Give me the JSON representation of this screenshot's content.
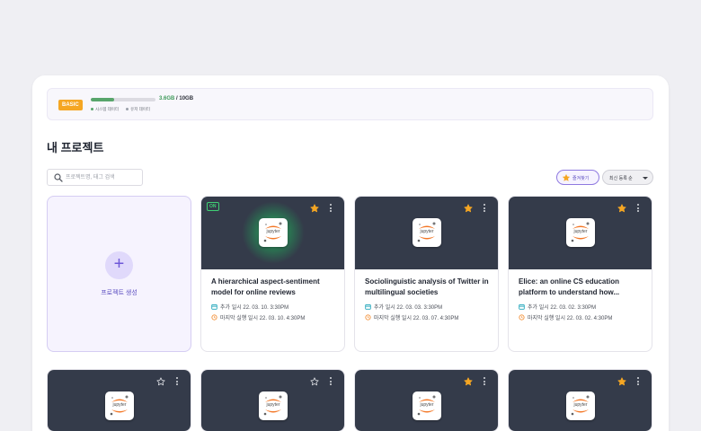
{
  "storage": {
    "plan": "BASIC",
    "used": "3.6GB",
    "separator": " / ",
    "total": "10GB",
    "usage_fraction": 0.36,
    "legend": [
      {
        "label": "시스템 데이터",
        "color": "#58a56b"
      },
      {
        "label": "유저 데이터",
        "color": "#9aa0aa"
      }
    ]
  },
  "page": {
    "title": "내 프로젝트"
  },
  "search": {
    "placeholder": "프로젝트명, 태그 검색",
    "icon": "search-icon"
  },
  "filters": {
    "favorites_label": "즐겨찾기",
    "sort_label": "최신 등록 순"
  },
  "create": {
    "label": "프로젝트 생성",
    "icon": "plus-icon"
  },
  "colors": {
    "accent": "#6e58d8",
    "star_active": "#f5a623",
    "thumb_bg": "#343b4a",
    "running": "#3fcf74"
  },
  "projects": [
    {
      "title": "A hierarchical aspect-sentiment model for online reviews",
      "status": "ON",
      "favorite": true,
      "logo_text": "jupyter",
      "added": "추가 일시 22. 03. 10. 3:30PM",
      "last_run": "마지막 실행 일시 22. 03. 10. 4:30PM"
    },
    {
      "title": "Sociolinguistic analysis of Twitter in multilingual societies",
      "status": "",
      "favorite": true,
      "logo_text": "jupyter",
      "added": "추가 일시 22. 03. 03. 3:30PM",
      "last_run": "마지막 실행 일시 22. 03. 07. 4:30PM"
    },
    {
      "title": "Elice: an online CS education platform to understand how...",
      "status": "",
      "favorite": true,
      "logo_text": "jupyter",
      "added": "추가 일시 22. 03. 02. 3:30PM",
      "last_run": "마지막 실행 일시 22. 03. 02. 4:30PM"
    },
    {
      "title": "",
      "favorite": false,
      "logo_text": "jupyter"
    },
    {
      "title": "",
      "favorite": false,
      "logo_text": "jupyter"
    },
    {
      "title": "",
      "favorite": true,
      "logo_text": "jupyter"
    },
    {
      "title": "",
      "favorite": true,
      "logo_text": "jupyter"
    }
  ]
}
